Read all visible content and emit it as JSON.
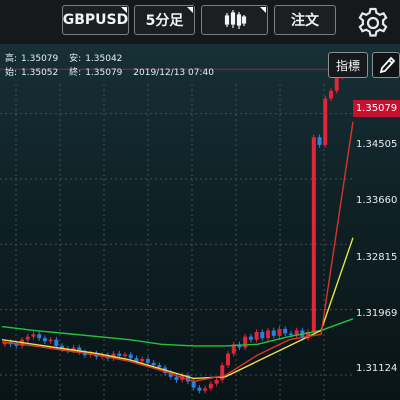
{
  "toolbar": {
    "symbol": "GBPUSD",
    "timeframe": "5分足",
    "chart_type_icon": "candlestick-icon",
    "order": "注文",
    "settings_icon": "gear-icon"
  },
  "info": {
    "high_label": "高:",
    "high": "1.35079",
    "low_label": "安:",
    "low": "1.35042",
    "open_label": "始:",
    "open": "1.35052",
    "close_label": "終:",
    "close": "1.35079",
    "datetime": "2019/12/13 07:40"
  },
  "buttons": {
    "indicator": "指標",
    "pencil_icon": "pencil-icon"
  },
  "price_axis": {
    "current": "1.35079",
    "ticks": [
      "1.34505",
      "1.33660",
      "1.32815",
      "1.31969",
      "1.31124"
    ]
  },
  "colors": {
    "up": "#e0263a",
    "down": "#2f7fe0",
    "ma_green": "#22c43a",
    "ma_yellow": "#e8e24a",
    "ma_red": "#d9342b",
    "current_line": "#c8102e"
  },
  "chart_data": {
    "type": "candlestick",
    "symbol": "GBPUSD",
    "timeframe": "5分足",
    "y_ticks": [
      1.34505,
      1.3366,
      1.32815,
      1.31969,
      1.31124
    ],
    "ylim": [
      1.308,
      1.3525
    ],
    "last_close": 1.35079,
    "close_series": [
      1.3155,
      1.3152,
      1.315,
      1.3158,
      1.3162,
      1.3165,
      1.316,
      1.3156,
      1.3158,
      1.315,
      1.3146,
      1.3144,
      1.3148,
      1.3142,
      1.3138,
      1.314,
      1.3136,
      1.3138,
      1.3134,
      1.314,
      1.3137,
      1.3139,
      1.3134,
      1.313,
      1.3133,
      1.3128,
      1.3125,
      1.3122,
      1.3115,
      1.311,
      1.3106,
      1.3112,
      1.3104,
      1.3096,
      1.3092,
      1.3095,
      1.3101,
      1.3106,
      1.3125,
      1.314,
      1.3152,
      1.3148,
      1.3162,
      1.3158,
      1.3168,
      1.316,
      1.317,
      1.3163,
      1.3172,
      1.3166,
      1.3164,
      1.317,
      1.316,
      1.3168,
      1.342,
      1.341,
      1.347,
      1.348,
      1.3498,
      1.3505,
      1.35079
    ],
    "series": [
      {
        "name": "",
        "color": "#22c43a",
        "values": [
          1.3175,
          1.317,
          1.3166,
          1.3162,
          1.3158,
          1.3152,
          1.315,
          1.315,
          1.3152,
          1.3162,
          1.317,
          1.3185
        ]
      },
      {
        "name": "",
        "color": "#e8e24a",
        "values": [
          1.3158,
          1.3152,
          1.3146,
          1.314,
          1.3132,
          1.312,
          1.3108,
          1.311,
          1.313,
          1.315,
          1.317,
          1.329
        ]
      },
      {
        "name": "",
        "color": "#d9342b",
        "values": [
          1.3155,
          1.315,
          1.3144,
          1.3138,
          1.313,
          1.3118,
          1.3104,
          1.3112,
          1.3138,
          1.3158,
          1.3165,
          1.344
        ]
      }
    ]
  }
}
